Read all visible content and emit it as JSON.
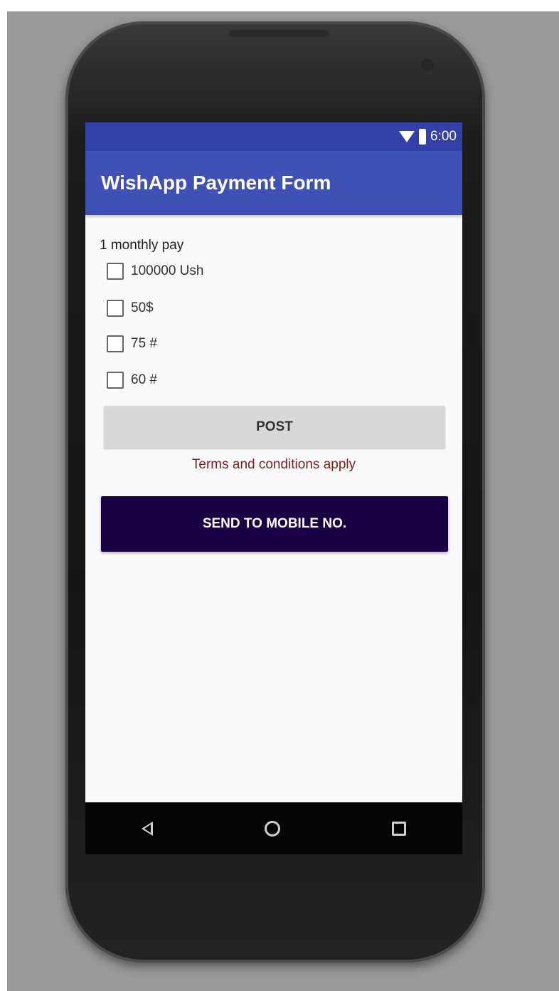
{
  "status_bar": {
    "time": "6:00",
    "icons": [
      "wifi-icon",
      "battery-icon"
    ]
  },
  "app_bar": {
    "title": "WishApp Payment Form",
    "color": "#3f51b5"
  },
  "form": {
    "section_label": "1 monthly pay",
    "options": [
      {
        "label": "100000 Ush",
        "checked": false
      },
      {
        "label": "50$",
        "checked": false
      },
      {
        "label": "75 #",
        "checked": false
      },
      {
        "label": "60 #",
        "checked": false
      }
    ],
    "post_label": "POST",
    "terms_text": "Terms and conditions apply",
    "send_label": "SEND TO MOBILE NO.",
    "send_color": "#1a0045"
  },
  "nav_bar": {
    "icons": [
      "back-icon",
      "home-icon",
      "recent-apps-icon"
    ]
  }
}
